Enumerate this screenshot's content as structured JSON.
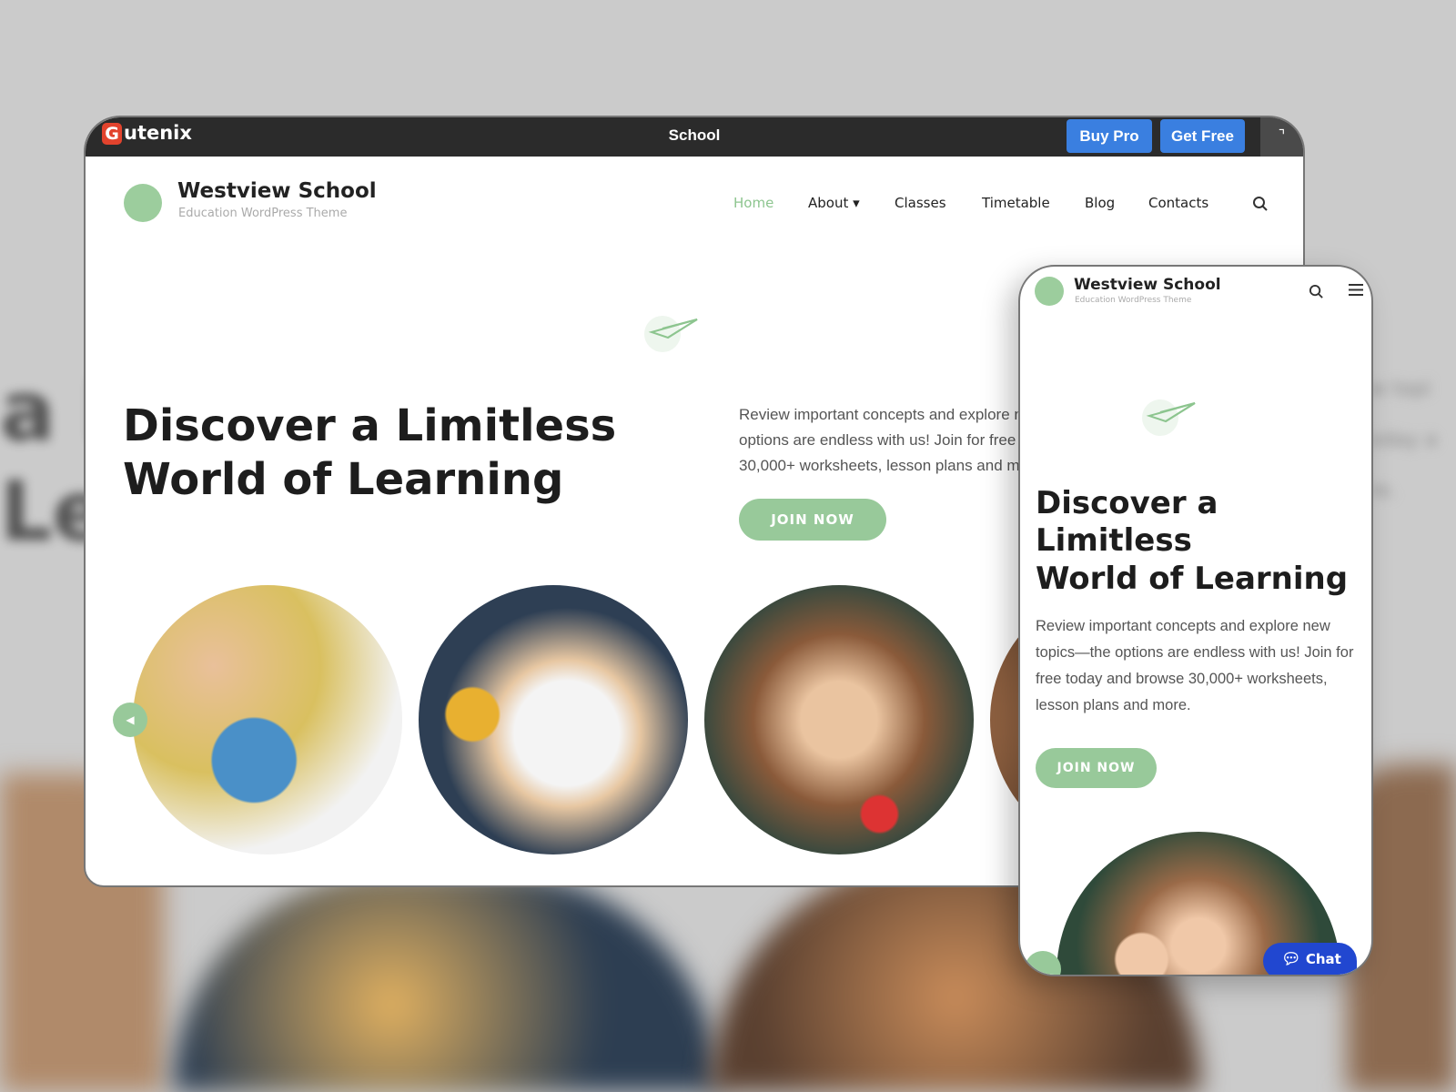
{
  "background": {
    "blur_text_left": [
      "a L",
      "Le"
    ],
    "blur_text_right": [
      "w topi",
      "oday a",
      "re."
    ]
  },
  "topbar": {
    "logo_letter": "G",
    "logo_rest": "utenix",
    "title": "School",
    "buy_pro": "Buy Pro",
    "get_free": "Get Free",
    "corner_icon": "⌝"
  },
  "site": {
    "title": "Westview School",
    "subtitle": "Education WordPress Theme"
  },
  "nav": {
    "items": [
      {
        "label": "Home",
        "active": true
      },
      {
        "label": "About ▾"
      },
      {
        "label": "Classes"
      },
      {
        "label": "Timetable"
      },
      {
        "label": "Blog"
      },
      {
        "label": "Contacts"
      }
    ]
  },
  "hero": {
    "heading_line1": "Discover a Limitless",
    "heading_line2": "World of Learning",
    "paragraph_desktop": "Review important concepts and explore new topics—the options are endless with us! Join for free today and browse 30,000+ worksheets, lesson plans and more.",
    "paragraph_mobile": "Review important concepts and explore new topics—the options are endless with us! Join for free today and browse 30,000+ worksheets, lesson plans and more.",
    "cta": "JOIN NOW"
  },
  "chat": {
    "label": "Chat"
  },
  "colors": {
    "accent_green": "#98c99a",
    "nav_active": "#8dc58f",
    "button_blue": "#3a7fe0",
    "chat_blue": "#2147d0",
    "topbar": "#2b2b2b"
  }
}
